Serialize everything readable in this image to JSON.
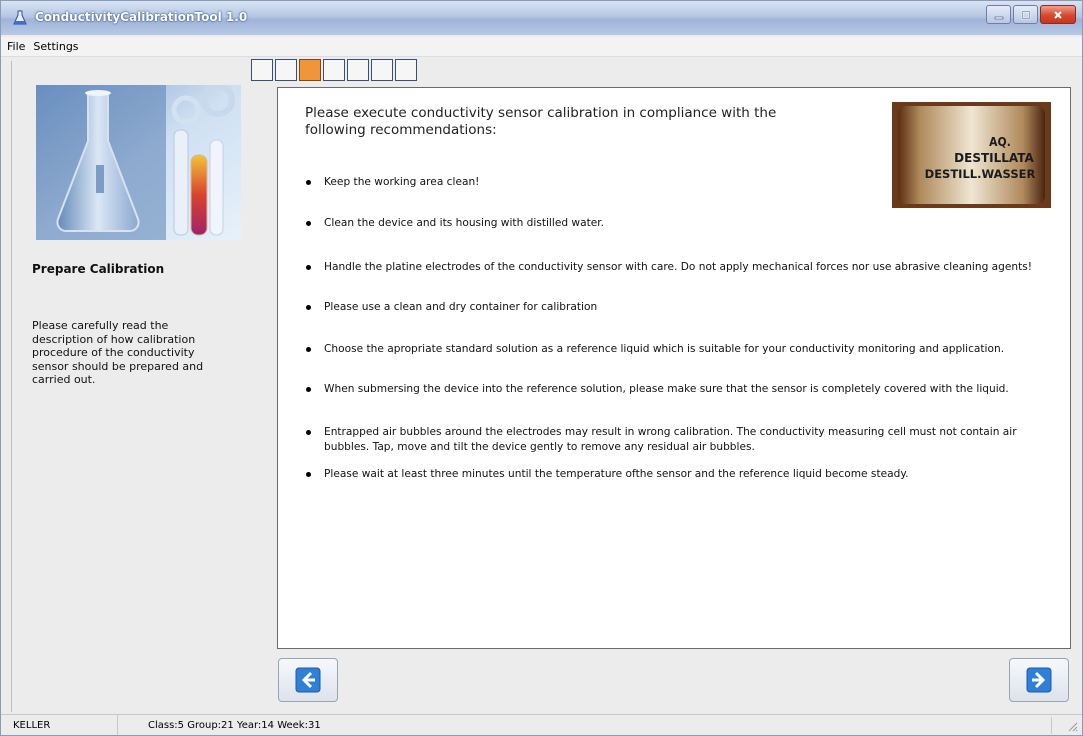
{
  "window": {
    "title": "ConductivityCalibrationTool 1.0",
    "app_icon": "flask-icon",
    "controls": [
      "minimize-icon",
      "maximize-icon",
      "close-icon"
    ]
  },
  "menu": {
    "items": [
      {
        "label": "File"
      },
      {
        "label": "Settings"
      }
    ]
  },
  "steps": {
    "total": 7,
    "active_index": 2,
    "active_color": "#f0953a"
  },
  "sidebar": {
    "heading": "Prepare Calibration",
    "description": "Please carefully read the\ndescription of how calibration\nprocedure of the conductivity\nsensor should be prepared and\ncarried out."
  },
  "content": {
    "intro": "Please execute conductivity sensor calibration in compliance with the following recommendations:",
    "photo": {
      "lines": [
        "AQ.",
        "DESTILLATA",
        "DESTILL.WASSER"
      ]
    },
    "bullets": [
      "Keep the working area clean!",
      "Clean the device and its housing with distilled water.",
      "Handle the platine electrodes of the conductivity sensor with care. Do not apply mechanical forces nor use abrasive cleaning agents!",
      "Please use a clean and dry container for calibration",
      "Choose the apropriate standard solution as a reference liquid which is suitable for your conductivity monitoring and application.",
      "When submersing the device into the reference solution, please make sure that the sensor is completely covered with the liquid.",
      "Entrapped air bubbles around the electrodes may result in wrong calibration. The conductivity measuring cell must not contain air bubbles. Tap, move and tilt the device gently to remove any residual air bubbles.",
      "Please wait at least three minutes until the temperature ofthe sensor and the reference liquid become steady."
    ]
  },
  "navigation": {
    "back_icon": "arrow-left-icon",
    "next_icon": "arrow-right-icon",
    "accent": "#2f7fd6"
  },
  "status": {
    "company": "KELLER",
    "info": "Class:5 Group:21 Year:14 Week:31"
  }
}
